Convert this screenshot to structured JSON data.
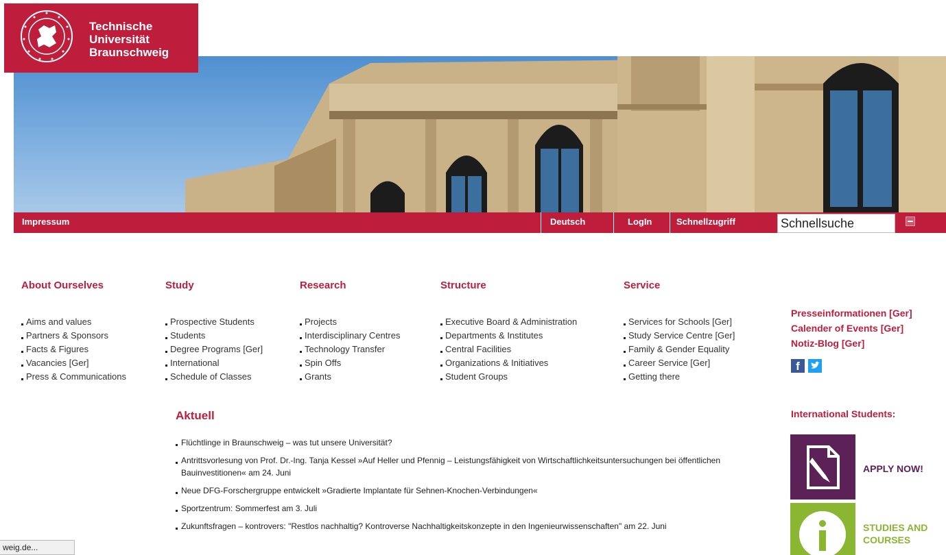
{
  "logo": {
    "line1": "Technische",
    "line2": "Universität",
    "line3": "Braunschweig"
  },
  "topbar": {
    "impressum": "Impressum",
    "deutsch": "Deutsch",
    "login": "LogIn",
    "schnellzugriff": "Schnellzugriff",
    "search_value": "Schnellsuche"
  },
  "nav": [
    {
      "title": "About Ourselves",
      "items": [
        "Aims and values",
        "Partners & Sponsors",
        "Facts & Figures",
        "Vacancies [Ger]",
        "Press & Communications"
      ]
    },
    {
      "title": "Study",
      "items": [
        "Prospective Students",
        "Students",
        "Degree Programs [Ger]",
        "International",
        "Schedule of Classes"
      ]
    },
    {
      "title": "Research",
      "items": [
        "Projects",
        "Interdisciplinary Centres",
        "Technology Transfer",
        "Spin Offs",
        "Grants"
      ]
    },
    {
      "title": "Structure",
      "items": [
        "Executive Board & Administration",
        "Departments & Institutes",
        "Central Facilities",
        "Organizations & Initiatives",
        "Student Groups"
      ]
    },
    {
      "title": "Service",
      "items": [
        "Services for Schools [Ger]",
        "Study Service Centre [Ger]",
        "Family & Gender Equality",
        "Career Service [Ger]",
        "Getting there"
      ]
    }
  ],
  "right": {
    "links": [
      "Presseinformationen [Ger]",
      "Calender of Events [Ger]",
      "Notiz-Blog [Ger]"
    ],
    "international_title": "International Students:",
    "apply_label": "APPLY NOW!",
    "studies_line1": "STUDIES AND",
    "studies_line2": "COURSES"
  },
  "news": {
    "title": "Aktuell",
    "items": [
      "Flüchtlinge in Braunschweig – was tut unsere Universität?",
      "Antrittsvorlesung von Prof. Dr.-Ing. Tanja Kessel »Auf Heller und Pfennig – Leistungsfähigkeit von Wirtschaftlichkeitsuntersuchungen bei öffentlichen Bauinvestitionen« am 24. Juni",
      "Neue DFG-Forschergruppe entwickelt »Gradierte Implantate für Sehnen-Knochen-Verbindungen«",
      "Sportzentrum: Sommerfest am 3. Juli",
      "Zukunftsfragen – kontrovers: \"Restlos nachhaltig? Kontroverse Nachhaltigkeitskonzepte in den Ingenieurwissenschaften\" am 22. Juni"
    ]
  },
  "status": {
    "text": "weig.de..."
  },
  "colors": {
    "brand_red": "#be1e3c",
    "apply_purple": "#5c2157",
    "studies_green": "#8bb631"
  }
}
